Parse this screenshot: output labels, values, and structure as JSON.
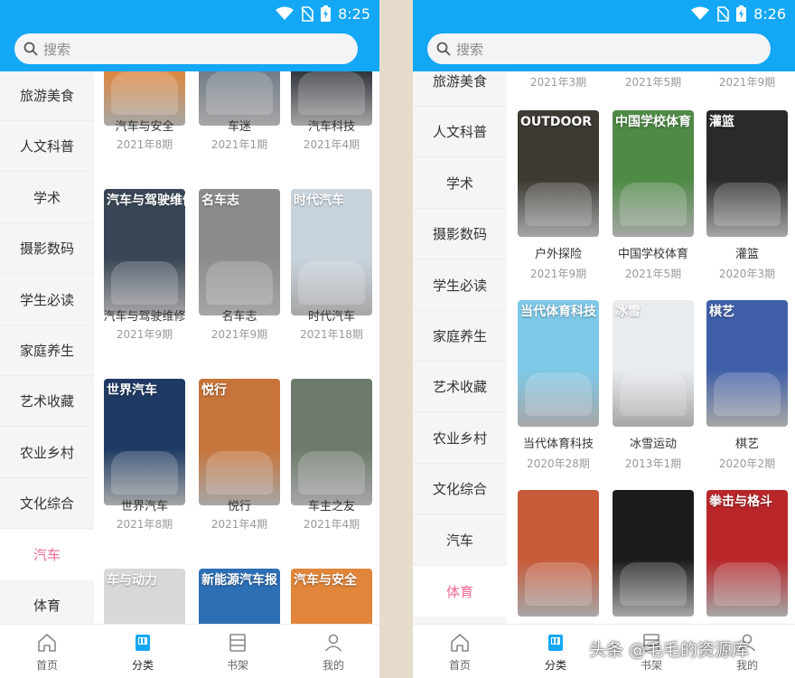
{
  "left": {
    "time": "8:25",
    "search_placeholder": "搜索",
    "sidebar": [
      {
        "label": "旅游美食"
      },
      {
        "label": "人文科普"
      },
      {
        "label": "学术"
      },
      {
        "label": "摄影数码"
      },
      {
        "label": "学生必读"
      },
      {
        "label": "家庭养生"
      },
      {
        "label": "艺术收藏"
      },
      {
        "label": "农业乡村"
      },
      {
        "label": "文化综合"
      },
      {
        "label": "汽车",
        "active": true
      },
      {
        "label": "体育"
      }
    ],
    "magazines": [
      {
        "name": "汽车与安全",
        "issue": "2021年8期",
        "cover_text": "",
        "color": "#e0853a"
      },
      {
        "name": "车迷",
        "issue": "2021年1期",
        "cover_text": "",
        "color": "#6f7a86"
      },
      {
        "name": "汽车科技",
        "issue": "2021年4期",
        "cover_text": "",
        "color": "#2b2f36"
      },
      {
        "name": "汽车与驾驶维修",
        "issue": "2021年9期",
        "cover_text": "汽车与驾驶维修",
        "color": "#3a4656"
      },
      {
        "name": "名车志",
        "issue": "2021年9期",
        "cover_text": "名车志",
        "color": "#8c8c8c"
      },
      {
        "name": "时代汽车",
        "issue": "2021年18期",
        "cover_text": "时代汽车",
        "color": "#c9d3dc"
      },
      {
        "name": "世界汽车",
        "issue": "2021年8期",
        "cover_text": "世界汽车",
        "color": "#1e3a64"
      },
      {
        "name": "悦行",
        "issue": "2021年4期",
        "cover_text": "悦行",
        "color": "#c7743a"
      },
      {
        "name": "车主之友",
        "issue": "2021年4期",
        "cover_text": "",
        "color": "#6d7a6c"
      },
      {
        "name": "",
        "issue": "",
        "cover_text": "车与动力",
        "color": "#d8d8d8"
      },
      {
        "name": "",
        "issue": "",
        "cover_text": "新能源汽车报",
        "color": "#2d6fb5"
      },
      {
        "name": "",
        "issue": "",
        "cover_text": "汽车与安全",
        "color": "#e0853a"
      }
    ],
    "nav": [
      {
        "label": "首页",
        "icon": "home-icon"
      },
      {
        "label": "分类",
        "icon": "category-icon",
        "active": true
      },
      {
        "label": "书架",
        "icon": "bookshelf-icon"
      },
      {
        "label": "我的",
        "icon": "profile-icon"
      }
    ]
  },
  "right": {
    "time": "8:26",
    "search_placeholder": "搜索",
    "sidebar": [
      {
        "label": "旅游美食"
      },
      {
        "label": "人文科普"
      },
      {
        "label": "学术"
      },
      {
        "label": "摄影数码"
      },
      {
        "label": "学生必读"
      },
      {
        "label": "家庭养生"
      },
      {
        "label": "艺术收藏"
      },
      {
        "label": "农业乡村"
      },
      {
        "label": "文化综合"
      },
      {
        "label": "汽车"
      },
      {
        "label": "体育",
        "active": true
      }
    ],
    "top_issues": [
      "2021年3期",
      "2021年5期",
      "2021年9期"
    ],
    "magazines": [
      {
        "name": "户外探险",
        "issue": "2021年9期",
        "cover_text": "OUTDOOR",
        "color": "#3d3a33"
      },
      {
        "name": "中国学校体育",
        "issue": "2021年5期",
        "cover_text": "中国学校体育",
        "color": "#4f8a46"
      },
      {
        "name": "灌篮",
        "issue": "2020年3期",
        "cover_text": "灌篮",
        "color": "#2a2a2a"
      },
      {
        "name": "当代体育科技",
        "issue": "2020年28期",
        "cover_text": "当代体育科技",
        "color": "#7ec9e8"
      },
      {
        "name": "冰雪运动",
        "issue": "2013年1期",
        "cover_text": "冰雪",
        "color": "#e8ecef"
      },
      {
        "name": "棋艺",
        "issue": "2020年2期",
        "cover_text": "棋艺",
        "color": "#3f5fa8"
      },
      {
        "name": "",
        "issue": "",
        "cover_text": "",
        "color": "#c85a3a"
      },
      {
        "name": "",
        "issue": "",
        "cover_text": "",
        "color": "#1b1b1b"
      },
      {
        "name": "",
        "issue": "",
        "cover_text": "拳击与格斗",
        "color": "#b8262a"
      }
    ],
    "nav": [
      {
        "label": "首页",
        "icon": "home-icon"
      },
      {
        "label": "分类",
        "icon": "category-icon",
        "active": true
      },
      {
        "label": "书架",
        "icon": "bookshelf-icon"
      },
      {
        "label": "我的",
        "icon": "profile-icon"
      }
    ]
  },
  "watermark": "头条 @毛毛的资源库"
}
